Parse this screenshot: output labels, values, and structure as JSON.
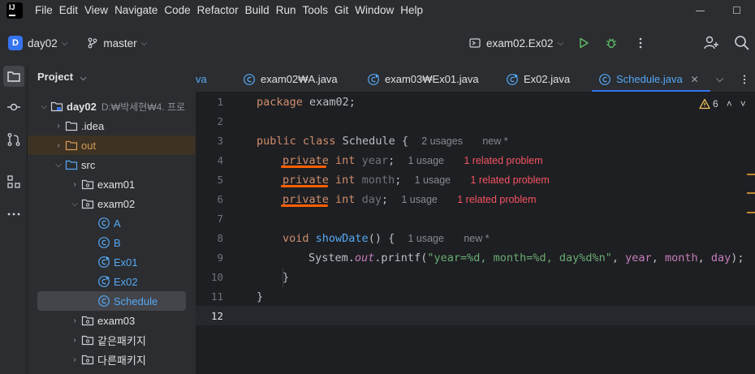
{
  "menu": [
    "File",
    "Edit",
    "View",
    "Navigate",
    "Code",
    "Refactor",
    "Build",
    "Run",
    "Tools",
    "Git",
    "Window",
    "Help"
  ],
  "window_buttons": {
    "minimize": "—",
    "maximize": "☐"
  },
  "toolbar": {
    "project_badge": "D",
    "project_name": "day02",
    "branch": "master",
    "run_config": "exam02.Ex02"
  },
  "project_panel": {
    "title": "Project",
    "tree": [
      {
        "label": "day02",
        "extra": "D:₩박세현₩4. 프로"
      },
      {
        "label": ".idea"
      },
      {
        "label": "out"
      },
      {
        "label": "src"
      },
      {
        "label": "exam01"
      },
      {
        "label": "exam02"
      },
      {
        "label": "A"
      },
      {
        "label": "B"
      },
      {
        "label": "Ex01"
      },
      {
        "label": "Ex02"
      },
      {
        "label": "Schedule"
      },
      {
        "label": "exam03"
      },
      {
        "label": "같은패키지"
      },
      {
        "label": "다른패키지"
      }
    ]
  },
  "tabs": [
    {
      "label": "va"
    },
    {
      "label": "exam02₩A.java"
    },
    {
      "label": "exam03₩Ex01.java"
    },
    {
      "label": "Ex02.java"
    },
    {
      "label": "Schedule.java"
    }
  ],
  "editor": {
    "problem_count": "6",
    "line_numbers": [
      "1",
      "2",
      "3",
      "4",
      "5",
      "6",
      "7",
      "8",
      "9",
      "10",
      "11",
      "12"
    ],
    "code": {
      "l1_kw": "package",
      "l1_rest": " exam02;",
      "l3_kw": "public class",
      "l3_rest": " Schedule {",
      "l3_hint1": "2 usages",
      "l3_hint2": "new *",
      "private": "private",
      "int": "int",
      "l4_field": "year",
      "l5_field": "month",
      "l6_field": "day",
      "semi": ";",
      "usage": "1 usage",
      "problem": "1 related problem",
      "l8_kw": "void",
      "l8_fn": "showDate",
      "l8_rest": "() {",
      "l8_hint1": "1 usage",
      "l8_hint2": "new *",
      "l9_sys": "System.",
      "l9_out": "out",
      "l9_printf": ".printf(",
      "l9_str": "\"year=%d, month=%d, day%d%n\"",
      "l9_comma1": ", ",
      "l9_year": "year",
      "l9_comma2": ", ",
      "l9_month": "month",
      "l9_comma3": ", ",
      "l9_day": "day",
      "l9_end": ");",
      "l10": "}",
      "l11": "}"
    }
  }
}
